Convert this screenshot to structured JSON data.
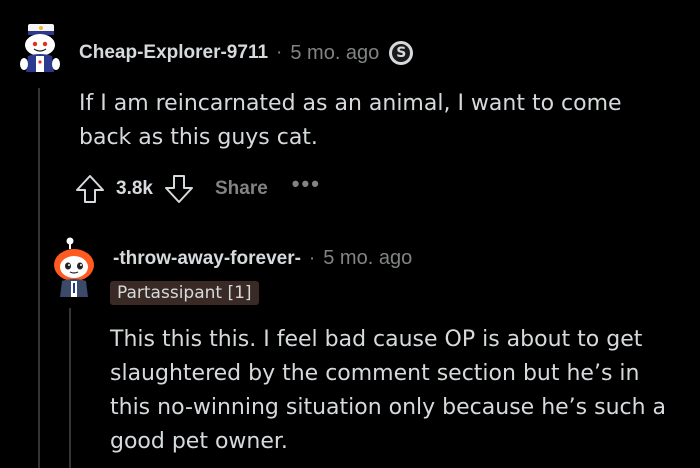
{
  "comments": [
    {
      "username": "Cheap-Explorer-9711",
      "separator": "·",
      "time": "5 mo. ago",
      "award_glyph": "S",
      "body": "If I am reincarnated as an animal, I want to come back as this guys cat.",
      "votes": "3.8k",
      "share_label": "Share",
      "more_label": "•••"
    },
    {
      "username": "-throw-away-forever-",
      "separator": "·",
      "time": "5 mo. ago",
      "flair": "Partassipant [1]",
      "body": "This this this. I feel bad cause OP is about to get slaughtered by the comment section but he’s in this no-winning situation only because he’s such a good pet owner."
    }
  ],
  "colors": {
    "background": "#000000",
    "text": "#d7dadc",
    "muted": "#818384",
    "thread_line": "#343536",
    "flair_bg": "#3a2a26"
  },
  "icons": [
    "sailor-snoo-avatar",
    "award-icon",
    "upvote-icon",
    "downvote-icon",
    "orange-hair-snoo-avatar"
  ]
}
